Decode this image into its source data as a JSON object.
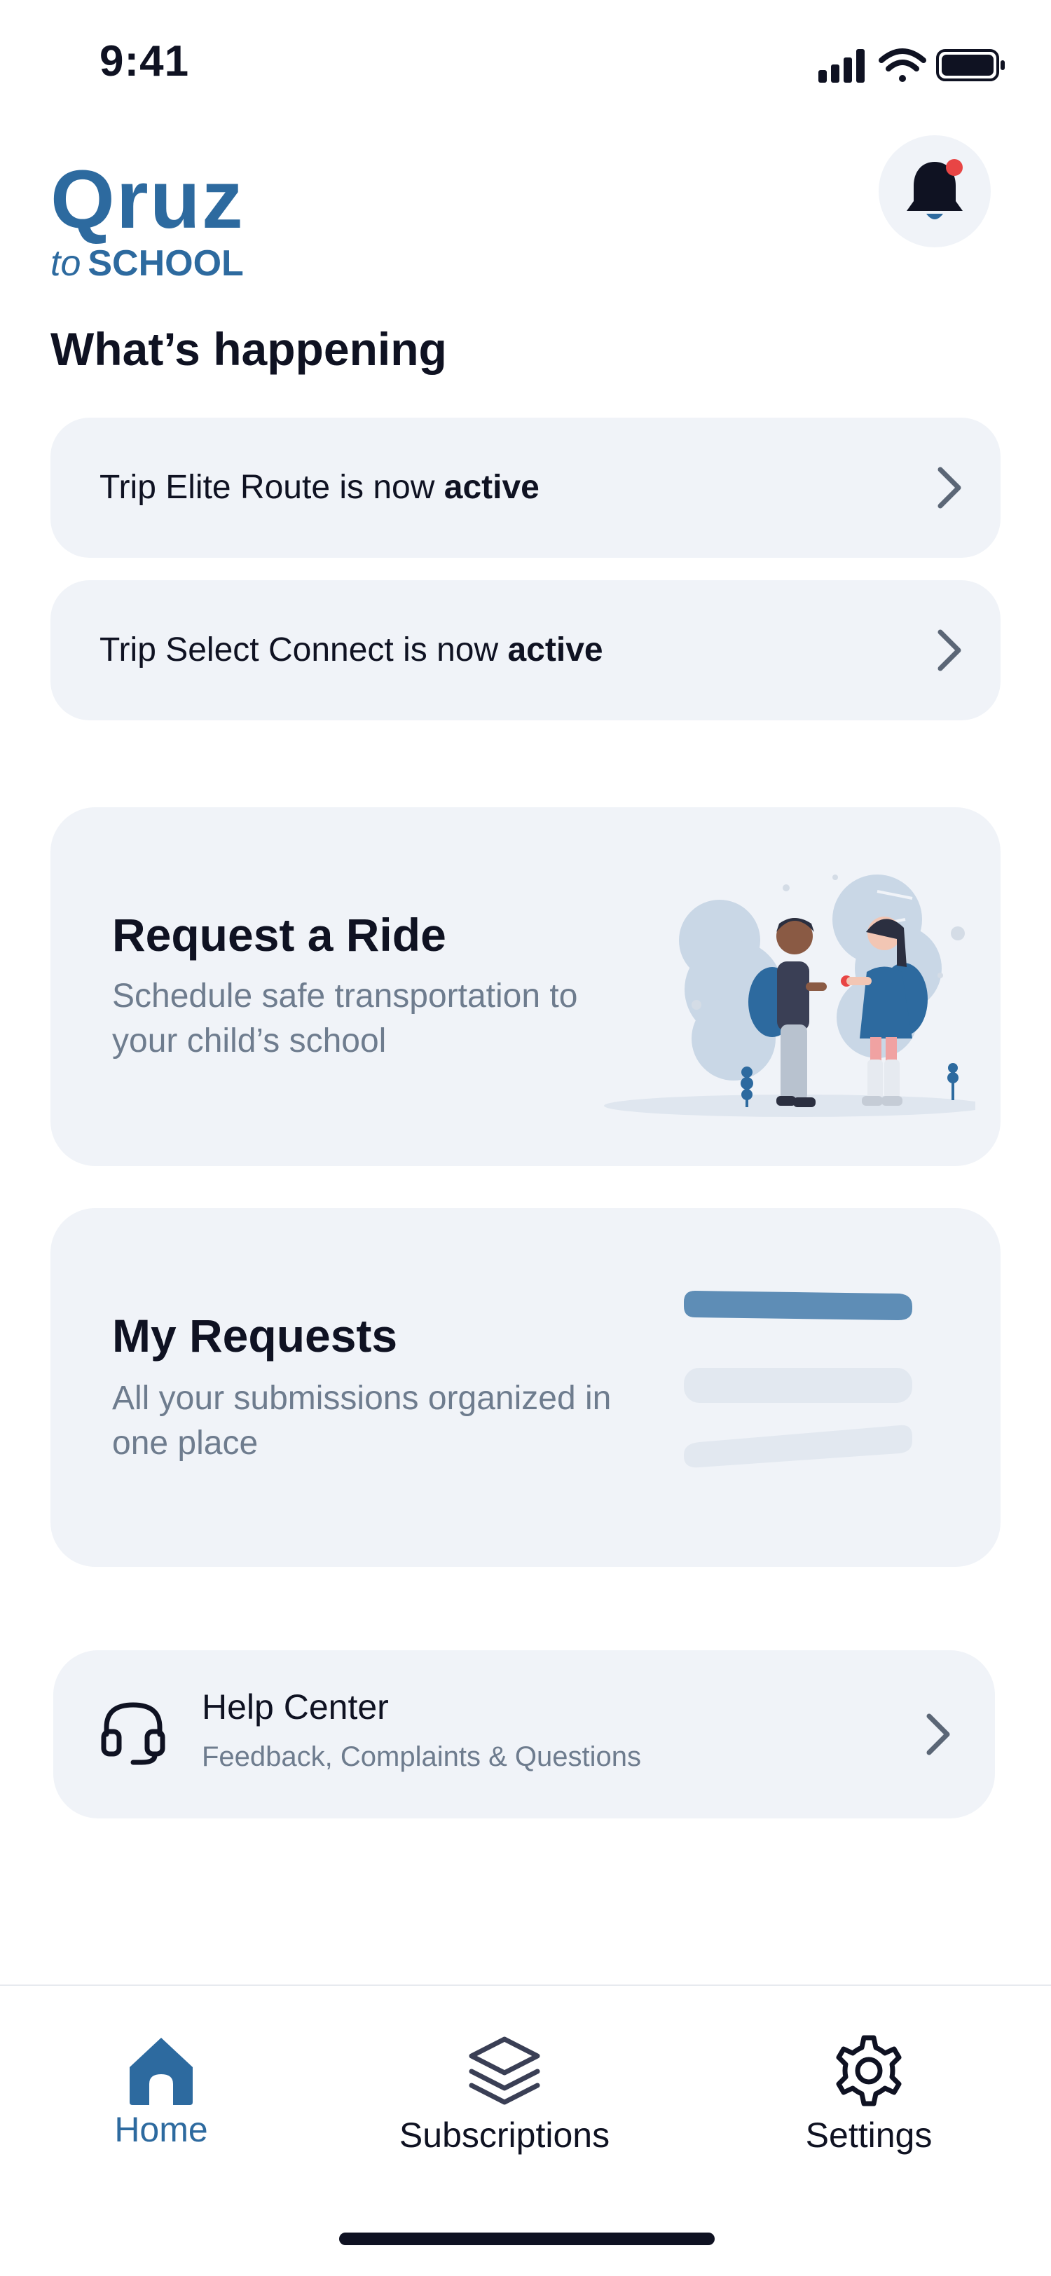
{
  "status_bar": {
    "time": "9:41"
  },
  "header": {
    "logo_main": "Qruz",
    "logo_sub_prefix": "to",
    "logo_sub": "SCHOOL"
  },
  "section_title": "What’s happening",
  "notifications": [
    {
      "prefix": "Trip ",
      "route": "Elite Route",
      "middle": " is now ",
      "status": "active"
    },
    {
      "prefix": "Trip ",
      "route": "Select Connect",
      "middle": " is now ",
      "status": "active"
    }
  ],
  "request_ride": {
    "title": "Request a Ride",
    "subtitle": "Schedule safe transportation to your child’s school"
  },
  "my_requests": {
    "title": "My Requests",
    "subtitle": "All your submissions organized in one place"
  },
  "help_center": {
    "title": "Help Center",
    "subtitle": "Feedback, Complaints & Questions"
  },
  "bottom_nav": {
    "items": [
      {
        "label": "Home",
        "active": true
      },
      {
        "label": "Subscriptions",
        "active": false
      },
      {
        "label": "Settings",
        "active": false
      }
    ]
  },
  "colors": {
    "brand": "#2d6a9f",
    "card_bg": "#f0f3f8",
    "text_primary": "#0f1222",
    "text_secondary": "#6e7c8e",
    "notification_dot": "#e84545"
  }
}
